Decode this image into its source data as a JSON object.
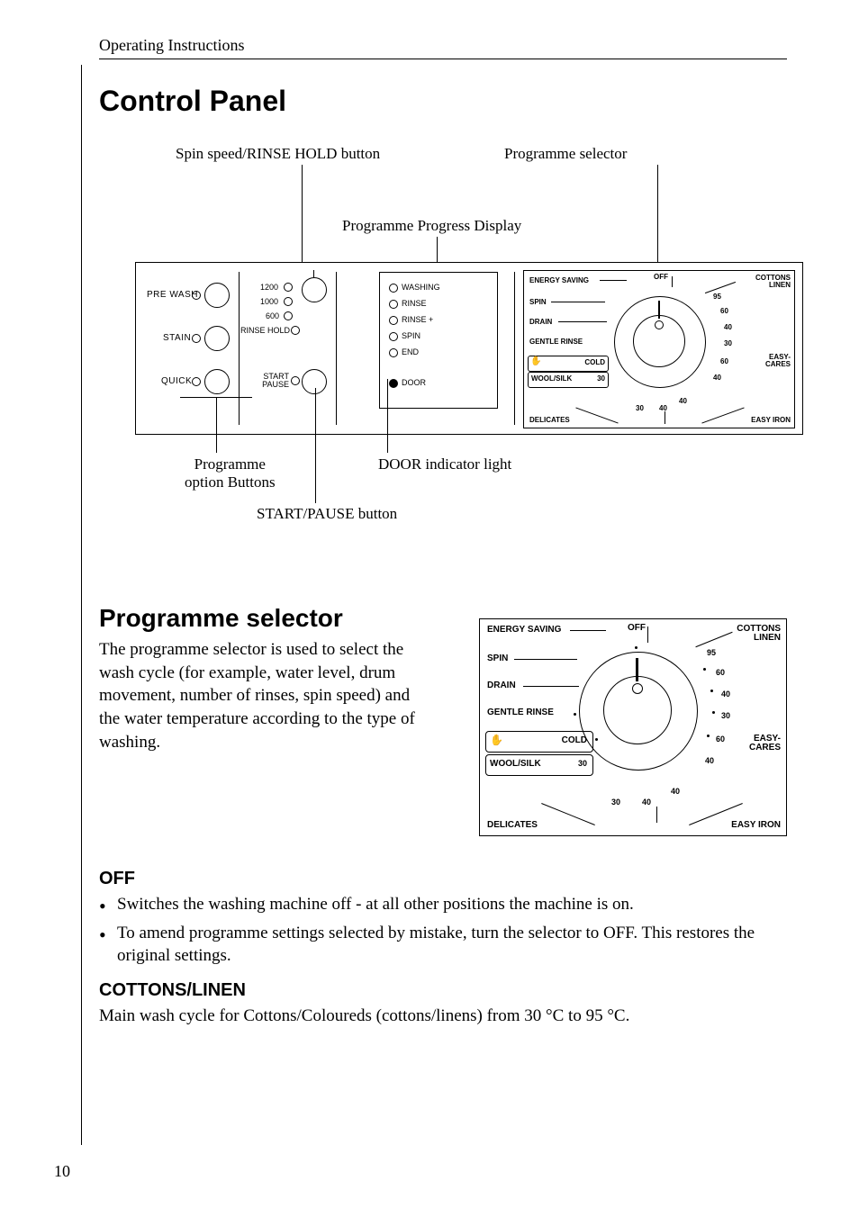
{
  "header": "Operating Instructions",
  "page_number": "10",
  "h1": "Control Panel",
  "diagram": {
    "callouts": {
      "spin_button": "Spin speed/RINSE HOLD button",
      "prog_selector": "Programme selector",
      "progress_display": "Programme Progress Display",
      "option_buttons": "Programme\noption Buttons",
      "door_light": "DOOR indicator light",
      "start_pause": "START/PAUSE button"
    },
    "panel": {
      "left_buttons": {
        "pre_wash": "PRE WASH",
        "stain": "STAIN",
        "quick": "QUICK"
      },
      "spin_col": {
        "s1200": "1200",
        "s1000": "1000",
        "s600": "600",
        "rinse_hold": "RINSE HOLD",
        "start_pause": "START\nPAUSE"
      },
      "progress": {
        "washing": "WASHING",
        "rinse": "RINSE",
        "rinse_plus": "RINSE +",
        "spin": "SPIN",
        "end": "END",
        "door": "DOOR"
      }
    },
    "dial": {
      "off": "OFF",
      "cottons": "COTTONS\nLINEN",
      "easy_cares": "EASY-\nCARES",
      "easy_iron": "EASY IRON",
      "delicates": "DELICATES",
      "wool_silk": "WOOL/SILK",
      "cold": "COLD",
      "gentle_rinse": "GENTLE RINSE",
      "drain": "DRAIN",
      "spin": "SPIN",
      "energy_saving": "ENERGY SAVING",
      "temps": {
        "t95": "95",
        "t60a": "60",
        "t40a": "40",
        "t30a": "30",
        "t60b": "60",
        "t40b": "40",
        "t40c": "40",
        "t40d": "40",
        "t30b": "30",
        "t30c": "30"
      }
    }
  },
  "section2": {
    "title": "Programme selector",
    "intro": "The programme selector is used to select the wash cycle (for example, water level, drum movement, number of rinses, spin speed) and the water temperature according to the type of washing.",
    "off": {
      "title": "OFF",
      "b1": "Switches the washing machine off - at all other positions the machine is on.",
      "b2": "To amend programme settings selected by mistake, turn the selector to OFF. This restores the original settings."
    },
    "cottons": {
      "title": "COTTONS/LINEN",
      "text": "Main wash cycle for Cottons/Coloureds (cottons/linens) from 30 °C to 95 °C."
    }
  }
}
